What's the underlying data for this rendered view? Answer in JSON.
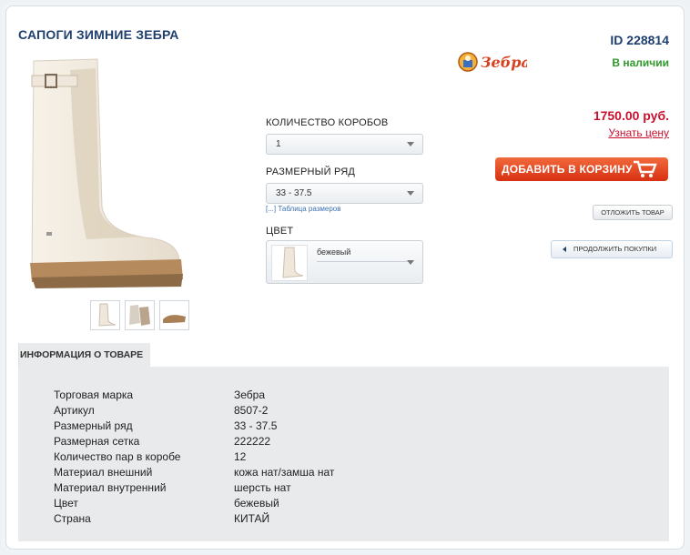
{
  "product": {
    "title": "САПОГИ ЗИМНИЕ ЗЕБРА",
    "id": "ID 228814",
    "brand_logo_text": "Зебра",
    "availability": "В наличии",
    "price": "1750.00 руб.",
    "ask_price_link": "Узнать цену"
  },
  "options": {
    "boxes_label": "КОЛИЧЕСТВО КОРОБОВ",
    "boxes_value": "1",
    "size_label": "РАЗМЕРНЫЙ РЯД",
    "size_value": "33 - 37.5",
    "size_chart_link": "[...] Таблица размеров",
    "color_label": "ЦВЕТ",
    "color_value": "бежевый"
  },
  "actions": {
    "add_to_cart": "ДОБАВИТЬ В КОРЗИНУ",
    "defer": "ОТЛОЖИТЬ ТОВАР",
    "continue": "ПРОДОЛЖИТЬ ПОКУПКИ"
  },
  "info": {
    "tab_label": "ИНФОРМАЦИЯ О ТОВАРЕ",
    "rows": [
      {
        "key": "Торговая марка",
        "value": "Зебра"
      },
      {
        "key": "Артикул",
        "value": "8507-2"
      },
      {
        "key": "Размерный ряд",
        "value": "33 - 37.5"
      },
      {
        "key": "Размерная сетка",
        "value": "222222"
      },
      {
        "key": "Количество пар в коробе",
        "value": "12"
      },
      {
        "key": "Материал внешний",
        "value": "кожа нат/замша нат"
      },
      {
        "key": "Материал внутренний",
        "value": "шерсть нат"
      },
      {
        "key": "Цвет",
        "value": "бежевый"
      },
      {
        "key": "Страна",
        "value": "КИТАЙ"
      }
    ]
  },
  "colors": {
    "title": "#1f3f6e",
    "stock": "#2f9a2b",
    "price": "#c8102e",
    "cart_button": "#e8491f"
  },
  "icons": [
    "brand-logo-image",
    "cart-icon",
    "chevron-down-icon",
    "triangle-left-icon"
  ]
}
